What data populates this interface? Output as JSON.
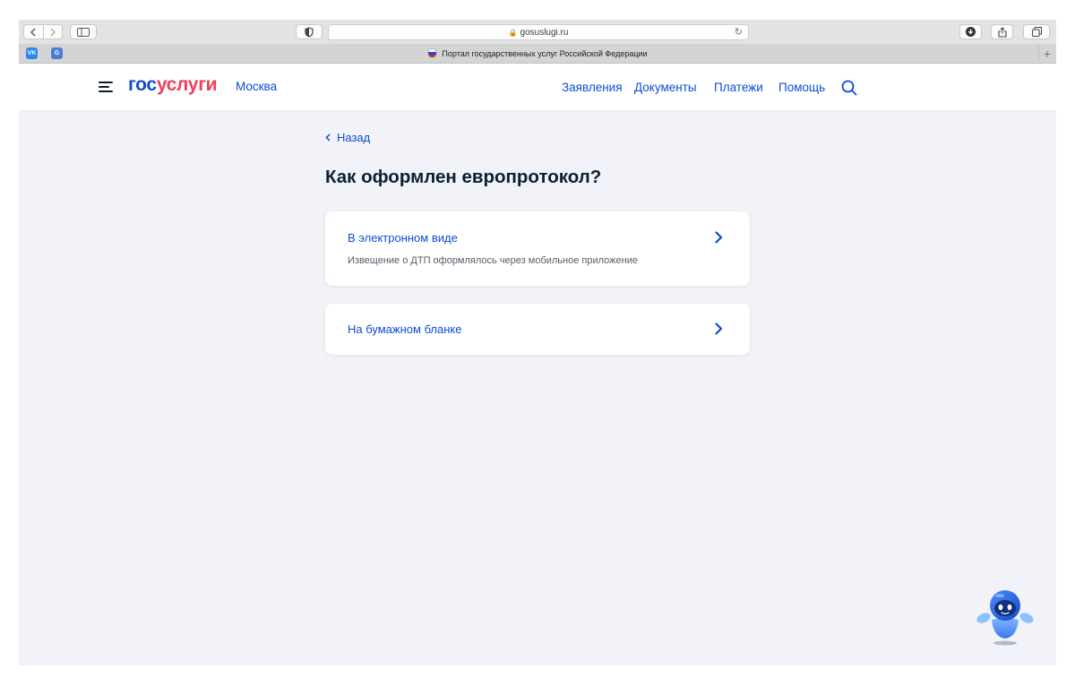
{
  "browser": {
    "url": "gosuslugi.ru",
    "tab_title": "Портал государственных услуг Российской Федерации",
    "favicons": [
      {
        "name": "vk",
        "text": "VK",
        "color": "#2787f5"
      },
      {
        "name": "translate",
        "text": "G",
        "color": "#4a7bd8"
      }
    ]
  },
  "header": {
    "logo_part1": "гос",
    "logo_part2": "услуги",
    "city": "Москва",
    "nav": [
      "Заявления",
      "Документы",
      "Платежи",
      "Помощь"
    ]
  },
  "page": {
    "back_label": "Назад",
    "title": "Как оформлен европротокол?",
    "options": [
      {
        "title": "В электронном виде",
        "subtitle": "Извещение о ДТП оформлялось через мобильное приложение"
      },
      {
        "title": "На бумажном бланке"
      }
    ]
  },
  "colors": {
    "primary": "#0d4cd3",
    "logo_accent": "#ee3f58",
    "text_dark": "#0b1f33",
    "page_bg": "#f1f3f8"
  }
}
